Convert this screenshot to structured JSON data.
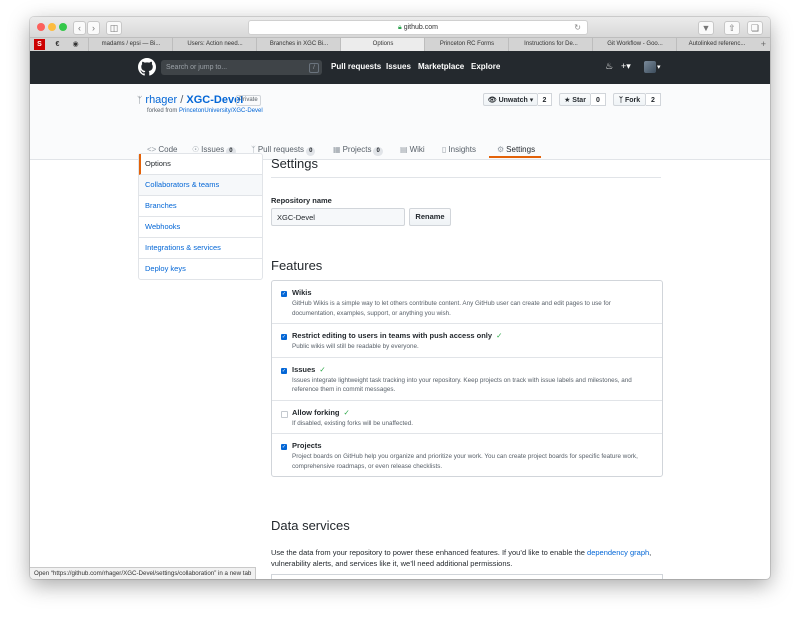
{
  "browser": {
    "address": "github.com",
    "tabs": [
      "madams / epsi — Bi...",
      "Users: Action need...",
      "Branches in XGC Bi...",
      "Options",
      "Princeton RC Forms",
      "Instructions for De...",
      "Git Workflow - Goo...",
      "Autolinked referenc..."
    ],
    "status_url": "Open “https://github.com/rhager/XGC-Devel/settings/collaboration” in a new tab"
  },
  "github_header": {
    "search_placeholder": "Search or jump to...",
    "search_key": "/",
    "nav": [
      "Pull requests",
      "Issues",
      "Marketplace",
      "Explore"
    ]
  },
  "repo": {
    "owner": "rhager",
    "separator": "/",
    "name": "XGC-Devel",
    "visibility": "Private",
    "forked_from_prefix": "forked from",
    "forked_from": "PrincetonUniversity/XGC-Devel",
    "unwatch_label": "Unwatch ▾",
    "unwatch_count": "2",
    "star_label": "Star",
    "star_count": "0",
    "fork_label": "Fork",
    "fork_count": "2",
    "nav": {
      "code": "Code",
      "issues": "Issues",
      "issues_count": "0",
      "pulls": "Pull requests",
      "pulls_count": "0",
      "projects": "Projects",
      "projects_count": "0",
      "wiki": "Wiki",
      "insights": "Insights",
      "settings": "Settings"
    }
  },
  "sidebar": {
    "items": [
      "Options",
      "Collaborators & teams",
      "Branches",
      "Webhooks",
      "Integrations & services",
      "Deploy keys"
    ]
  },
  "settings": {
    "title": "Settings",
    "repo_name_label": "Repository name",
    "repo_name_value": "XGC-Devel",
    "rename_button": "Rename"
  },
  "features": {
    "title": "Features",
    "items": [
      {
        "title": "Wikis",
        "checked": true,
        "desc": "GitHub Wikis is a simple way to let others contribute content. Any GitHub user can create and edit pages to use for documentation, examples, support, or anything you wish."
      },
      {
        "title": "Restrict editing to users in teams with push access only",
        "checked": true,
        "desc": "Public wikis will still be readable by everyone."
      },
      {
        "title": "Issues",
        "checked": true,
        "desc": "Issues integrate lightweight task tracking into your repository. Keep projects on track with issue labels and milestones, and reference them in commit messages."
      },
      {
        "title": "Allow forking",
        "checked": false,
        "desc": "If disabled, existing forks will be unaffected."
      },
      {
        "title": "Projects",
        "checked": true,
        "desc": "Project boards on GitHub help you organize and prioritize your work. You can create project boards for specific feature work, comprehensive roadmaps, or even release checklists."
      }
    ]
  },
  "data_services": {
    "title": "Data services",
    "text_before": "Use the data from your repository to power these enhanced features. If you’d like to enable the ",
    "link": "dependency graph",
    "text_after": ", vulnerability alerts, and services like it, we’ll need additional permissions."
  },
  "colors": {
    "accent_orange": "#e36209",
    "link_blue": "#0366d6",
    "header_dark": "#24292e",
    "check_green": "#28a745"
  }
}
